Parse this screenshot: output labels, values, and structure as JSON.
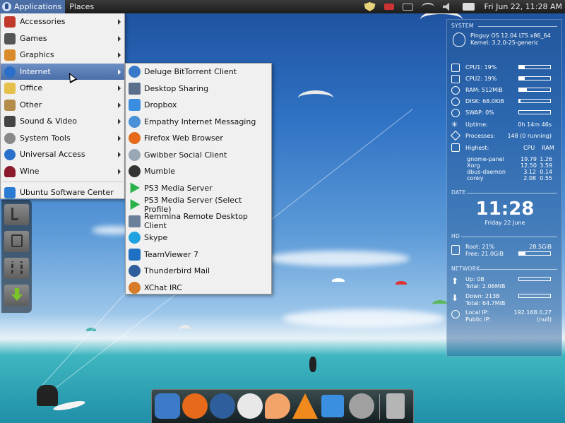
{
  "top_panel": {
    "applications_label": "Applications",
    "places_label": "Places",
    "clock": "Fri Jun 22, 11:28 AM",
    "tray_icons": [
      "shield-icon",
      "battery-icon",
      "mail-icon",
      "network-icon",
      "volume-icon",
      "display-icon"
    ]
  },
  "menu": {
    "items": [
      {
        "label": "Accessories",
        "icon": "accessories-icon",
        "color": "#c0392b"
      },
      {
        "label": "Games",
        "icon": "games-icon",
        "color": "#555555"
      },
      {
        "label": "Graphics",
        "icon": "graphics-icon",
        "color": "#d98b2b"
      },
      {
        "label": "Internet",
        "icon": "internet-icon",
        "color": "#2a6fc9"
      },
      {
        "label": "Office",
        "icon": "office-icon",
        "color": "#e5c04a"
      },
      {
        "label": "Other",
        "icon": "other-icon",
        "color": "#b58d4a"
      },
      {
        "label": "Sound & Video",
        "icon": "sound-video-icon",
        "color": "#444444"
      },
      {
        "label": "System Tools",
        "icon": "system-tools-icon",
        "color": "#888888"
      },
      {
        "label": "Universal Access",
        "icon": "universal-access-icon",
        "color": "#2a6fc9"
      },
      {
        "label": "Wine",
        "icon": "wine-icon",
        "color": "#8b1a2b"
      }
    ],
    "software_center": {
      "label": "Ubuntu Software Center",
      "icon": "software-center-icon",
      "color": "#2a7bd1"
    }
  },
  "submenu": {
    "items": [
      {
        "label": "Deluge BitTorrent Client",
        "icon": "deluge-icon",
        "color": "#3a78c8"
      },
      {
        "label": "Desktop Sharing",
        "icon": "desktop-sharing-icon",
        "color": "#5a6f8a"
      },
      {
        "label": "Dropbox",
        "icon": "dropbox-icon",
        "color": "#3b8de0"
      },
      {
        "label": "Empathy Internet Messaging",
        "icon": "empathy-icon",
        "color": "#4a90d9"
      },
      {
        "label": "Firefox Web Browser",
        "icon": "firefox-icon",
        "color": "#e66a1a"
      },
      {
        "label": "Gwibber Social Client",
        "icon": "gwibber-icon",
        "color": "#9aa7b5"
      },
      {
        "label": "Mumble",
        "icon": "mumble-icon",
        "color": "#333333"
      },
      {
        "label": "PS3 Media Server",
        "icon": "ps3-media-server-icon",
        "color": "#2bb34a"
      },
      {
        "label": "PS3 Media Server (Select Profile)",
        "icon": "ps3-media-server-profile-icon",
        "color": "#2bb34a"
      },
      {
        "label": "Remmina Remote Desktop Client",
        "icon": "remmina-icon",
        "color": "#6a7f99"
      },
      {
        "label": "Skype",
        "icon": "skype-icon",
        "color": "#1fa3e0"
      },
      {
        "label": "TeamViewer 7",
        "icon": "teamviewer-icon",
        "color": "#1f6fc4"
      },
      {
        "label": "Thunderbird Mail",
        "icon": "thunderbird-icon",
        "color": "#2f5e9c"
      },
      {
        "label": "XChat IRC",
        "icon": "xchat-icon",
        "color": "#d77b2a"
      }
    ]
  },
  "conky": {
    "system_header": "SYSTEM",
    "os": "Pinguy OS 12.04 LTS x86_64",
    "kernel": "Kernel: 3.2.0-25-generic",
    "cpu1": "CPU1: 19%",
    "cpu2": "CPU2: 19%",
    "ram": "RAM: 512MiB",
    "disk": "DISK: 68.0KiB",
    "swap": "SWAP: 0%",
    "cpu1_level": 0.19,
    "cpu2_level": 0.19,
    "ram_level": 0.25,
    "disk_level": 0.05,
    "swap_level": 0.0,
    "uptime_label": "Uptime:",
    "uptime_value": "0h 14m 46s",
    "processes_label": "Processes:",
    "processes_value": "148 (0 running)",
    "highest_label": "Highest:",
    "col_cpu": "CPU",
    "col_ram": "RAM",
    "processes": [
      {
        "name": "gnome-panel",
        "cpu": "19.79",
        "ram": "1.26"
      },
      {
        "name": "Xorg",
        "cpu": "12.50",
        "ram": "3.59"
      },
      {
        "name": "dbus-daemon",
        "cpu": "3.12",
        "ram": "0.14"
      },
      {
        "name": "conky",
        "cpu": "2.08",
        "ram": "0.55"
      }
    ],
    "date_header": "DATE",
    "time": "11:28",
    "date": "Friday 22 June",
    "hd_header": "HD",
    "root": "Root: 21%",
    "root_size": "28.5GiB",
    "free": "Free: 21.0GiB",
    "root_level": 0.21,
    "network_header": "NETWORK",
    "up": "Up: 0B",
    "up_total": "Total: 2.06MiB",
    "down": "Down: 213B",
    "down_total": "Total: 64.7MiB",
    "local_ip": "Local IP:",
    "local_ip_value": "192.168.0.27",
    "public_ip": "Public IP:",
    "public_ip_value": "(null)"
  },
  "desktop_folders": [
    "music-folder-icon",
    "pictures-folder-icon",
    "videos-folder-icon",
    "downloads-folder-icon"
  ],
  "dock": {
    "items": [
      {
        "icon": "anchor-icon",
        "color": "#3d7bc9"
      },
      {
        "icon": "firefox-icon",
        "color": "#e66a1a"
      },
      {
        "icon": "thunderbird-icon",
        "color": "#2f5e9c"
      },
      {
        "icon": "xchat-icon",
        "color": "#e8e8e8"
      },
      {
        "icon": "peach-icon",
        "color": "#f2a46b"
      },
      {
        "icon": "vlc-icon",
        "color": "#f08a1c"
      },
      {
        "icon": "download-icon",
        "color": "#3a8fe0"
      },
      {
        "icon": "gear-icon",
        "color": "#a0a0a0"
      },
      {
        "icon": "trash-icon",
        "color": "#b5b5b5"
      }
    ]
  }
}
